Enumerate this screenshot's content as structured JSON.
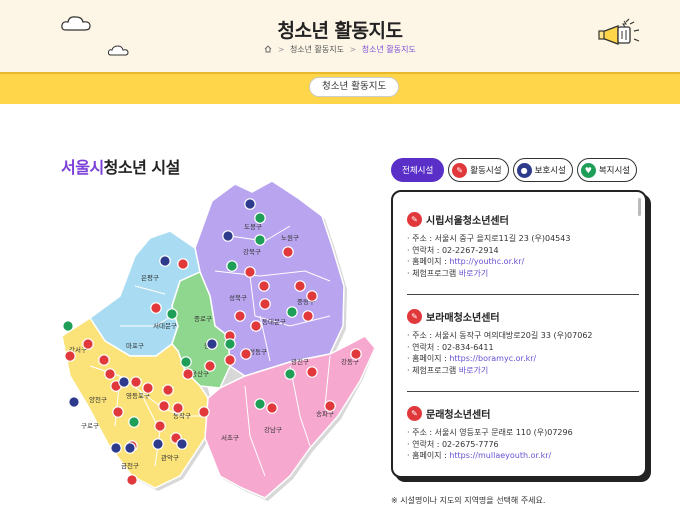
{
  "header": {
    "title": "청소년 활동지도",
    "breadcrumb": {
      "home_icon": "home-icon",
      "parent": "청소년 활동지도",
      "separator": ">",
      "current": "청소년 활동지도"
    }
  },
  "tab": {
    "label": "청소년 활동지도"
  },
  "section": {
    "title_accent": "서울시",
    "title_rest": "청소년 시설"
  },
  "filters": [
    {
      "label": "전체시설",
      "active": true
    },
    {
      "label": "활동시설",
      "icon": "activity-icon",
      "icon_color": "#e0383b"
    },
    {
      "label": "보호시설",
      "icon": "protection-icon",
      "icon_color": "#2e3a8c"
    },
    {
      "label": "복지시설",
      "icon": "welfare-icon",
      "icon_color": "#1f9e58"
    }
  ],
  "map": {
    "districts": [
      "도봉구",
      "노원구",
      "강북구",
      "은평구",
      "성북구",
      "중랑구",
      "종로구",
      "동대문구",
      "서대문구",
      "마포구",
      "중구",
      "성동구",
      "광진구",
      "용산구",
      "강동구",
      "강서구",
      "양천구",
      "영등포구",
      "동작구",
      "구로구",
      "금천구",
      "관악구",
      "서초구",
      "강남구",
      "송파구"
    ],
    "colors": {
      "north_east": "#b9a4f0",
      "north_west": "#a9dcf2",
      "center": "#8fd68f",
      "west_south": "#fbe37a",
      "south_east": "#f7a8cf"
    }
  },
  "facilities": [
    {
      "name": "시립서울청소년센터",
      "address_label": "주소",
      "address": "서울시 중구 을지로11길 23 (우)04543",
      "phone_label": "연락처",
      "phone": "02-2267-2914",
      "homepage_label": "홈페이지",
      "homepage": "http://youthc.or.kr/",
      "program_label": "체험프로그램",
      "program_link": "바로가기"
    },
    {
      "name": "보라매청소년센터",
      "address_label": "주소",
      "address": "서울시 동작구 여의대방로20길 33 (우)07062",
      "phone_label": "연락처",
      "phone": "02-834-6411",
      "homepage_label": "홈페이지",
      "homepage": "https://boramyc.or.kr/",
      "program_label": "체험프로그램",
      "program_link": "바로가기"
    },
    {
      "name": "문래청소년센터",
      "address_label": "주소",
      "address": "서울시 영등포구 문래로 110 (우)07296",
      "phone_label": "연락처",
      "phone": "02-2675-7776",
      "homepage_label": "홈페이지",
      "homepage": "https://mullaeyouth.or.kr/"
    }
  ],
  "note": "※ 시설명이나 지도의 지역명을 선택해 주세요."
}
